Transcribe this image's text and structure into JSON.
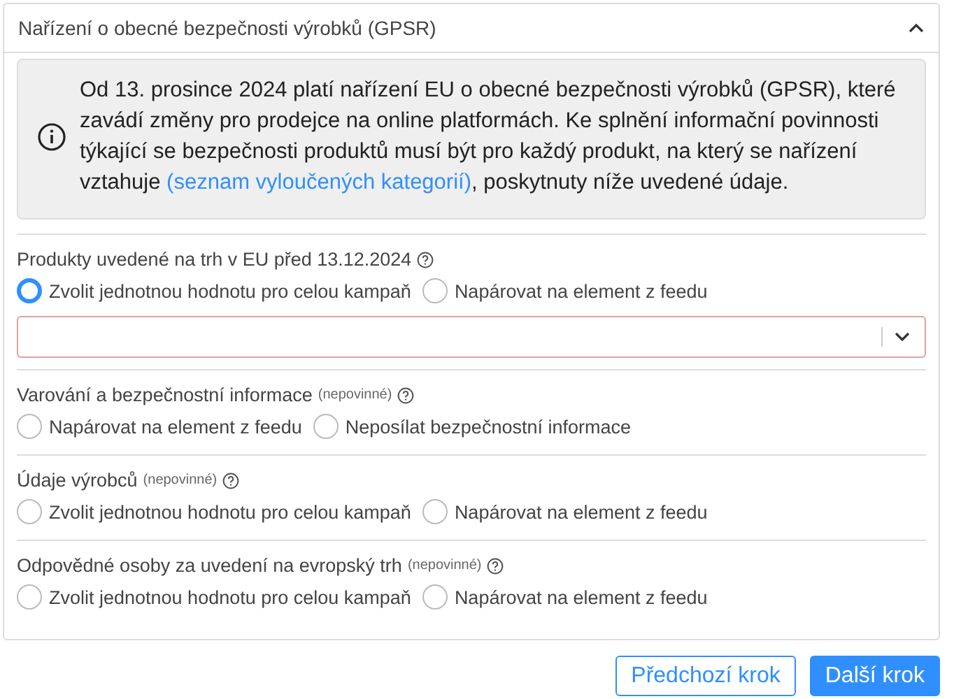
{
  "panel": {
    "title": "Nařízení o obecné bezpečnosti výrobků (GPSR)",
    "expanded": true
  },
  "notice": {
    "before": "Od 13. prosince 2024 platí nařízení EU o obecné bezpečnosti výrobků (GPSR), které zavádí změny pro prodejce na online platformách. Ke splnění informační povinnosti týkající se bezpečnosti produktů musí být pro každý produkt, na který se nařízení vztahuje ",
    "link": "(seznam vyloučených kategorií)",
    "after": ", poskytnuty níže uvedené údaje."
  },
  "sections": [
    {
      "label": "Produkty uvedené na trh v EU před 13.12.2024",
      "options": [
        {
          "label": "Zvolit jednotnou hodnotu pro celou kampaň",
          "selected": true
        },
        {
          "label": "Napárovat na element z feedu",
          "selected": false
        }
      ],
      "select": {
        "invalid": true
      }
    },
    {
      "label": "Varování a bezpečnostní informace",
      "note": "(nepovinné)",
      "options": [
        {
          "label": "Napárovat na element z feedu",
          "selected": false
        },
        {
          "label": "Neposílat bezpečnostní informace",
          "selected": false
        }
      ]
    },
    {
      "label": "Údaje výrobců",
      "note": "(nepovinné)",
      "options": [
        {
          "label": "Zvolit jednotnou hodnotu pro celou kampaň",
          "selected": false
        },
        {
          "label": "Napárovat na element z feedu",
          "selected": false
        }
      ]
    },
    {
      "label": "Odpovědné osoby za uvedení na evropský trh",
      "note": "(nepovinné)",
      "options": [
        {
          "label": "Zvolit jednotnou hodnotu pro celou kampaň",
          "selected": false
        },
        {
          "label": "Napárovat na element z feedu",
          "selected": false
        }
      ]
    }
  ],
  "buttons": [
    {
      "label": "Předchozí krok",
      "kind": "secondary"
    },
    {
      "label": "Další krok",
      "kind": "primary"
    }
  ]
}
